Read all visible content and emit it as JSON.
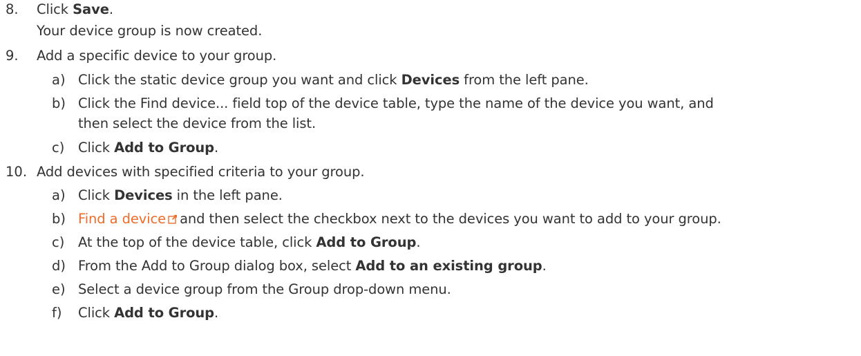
{
  "steps": {
    "s8": {
      "number": "8.",
      "pre": "Click ",
      "bold": "Save",
      "post": ".",
      "note": "Your device group is now created."
    },
    "s9": {
      "number": "9.",
      "text": "Add a specific device to your group.",
      "a": {
        "label": "a)",
        "pre": "Click the static device group you want and click ",
        "bold": "Devices",
        "post": " from the left pane."
      },
      "b": {
        "label": "b)",
        "line1": "Click the Find device... field top of the device table, type the name of the device you want, and",
        "line2": "then select the device from the list."
      },
      "c": {
        "label": "c)",
        "pre": "Click ",
        "bold": "Add to Group",
        "post": "."
      }
    },
    "s10": {
      "number": "10.",
      "text": "Add devices with specified criteria to your group.",
      "a": {
        "label": "a)",
        "pre": "Click ",
        "bold": "Devices",
        "post": " in the left pane."
      },
      "b": {
        "label": "b)",
        "link": "Find a device",
        "icon": "external-link-icon",
        "post": "and then select the checkbox next to the devices you want to add to your group."
      },
      "c": {
        "label": "c)",
        "pre": "At the top of the device table, click ",
        "bold": "Add to Group",
        "post": "."
      },
      "d": {
        "label": "d)",
        "pre": "From the Add to Group dialog box, select ",
        "bold": "Add to an existing group",
        "post": "."
      },
      "e": {
        "label": "e)",
        "text": "Select a device group from the Group drop-down menu."
      },
      "f": {
        "label": "f)",
        "pre": "Click ",
        "bold": "Add to Group",
        "post": "."
      }
    }
  },
  "colors": {
    "text": "#333333",
    "link": "#ee6c2a"
  }
}
